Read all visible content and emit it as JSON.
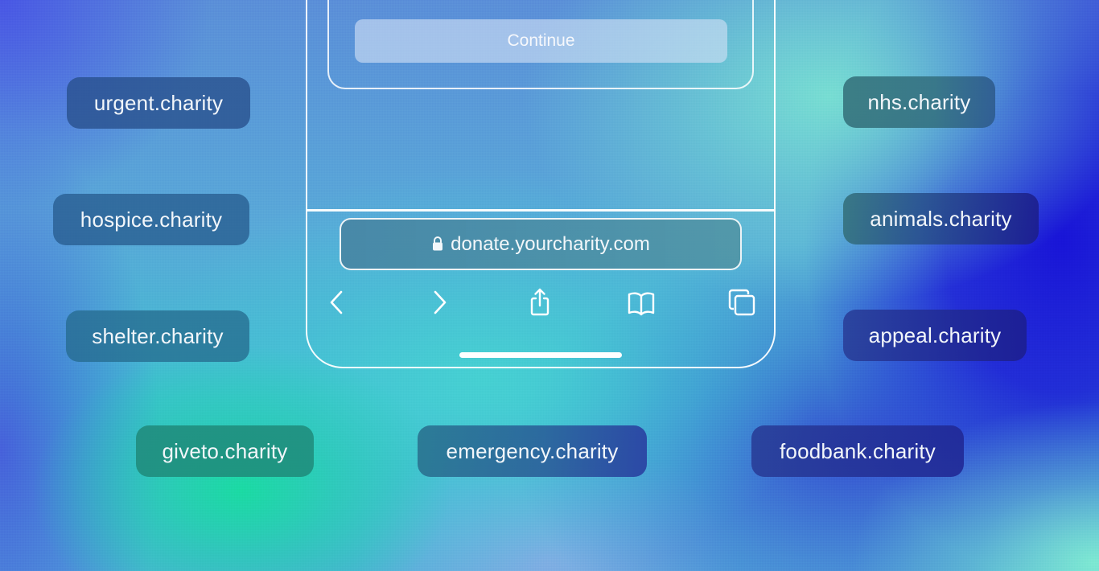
{
  "background": {
    "description": "grainy blue-teal-green gradient",
    "colors": [
      "#1a18d8",
      "#4a8fd8",
      "#3fbfd0",
      "#18dca0",
      "#80e8d2"
    ]
  },
  "phone": {
    "continue_button": {
      "label": "Continue"
    },
    "address_bar": {
      "icon": "lock-icon",
      "url": "donate.yourcharity.com"
    },
    "toolbar": [
      {
        "name": "back",
        "icon": "chevron-left-icon"
      },
      {
        "name": "forward",
        "icon": "chevron-right-icon"
      },
      {
        "name": "share",
        "icon": "share-icon"
      },
      {
        "name": "bookmarks",
        "icon": "book-icon"
      },
      {
        "name": "tabs",
        "icon": "tabs-icon"
      }
    ]
  },
  "domains": {
    "left": [
      "urgent.charity",
      "hospice.charity",
      "shelter.charity"
    ],
    "bottom": [
      "giveto.charity",
      "emergency.charity",
      "foodbank.charity"
    ],
    "right": [
      "nhs.charity",
      "animals.charity",
      "appeal.charity"
    ]
  }
}
